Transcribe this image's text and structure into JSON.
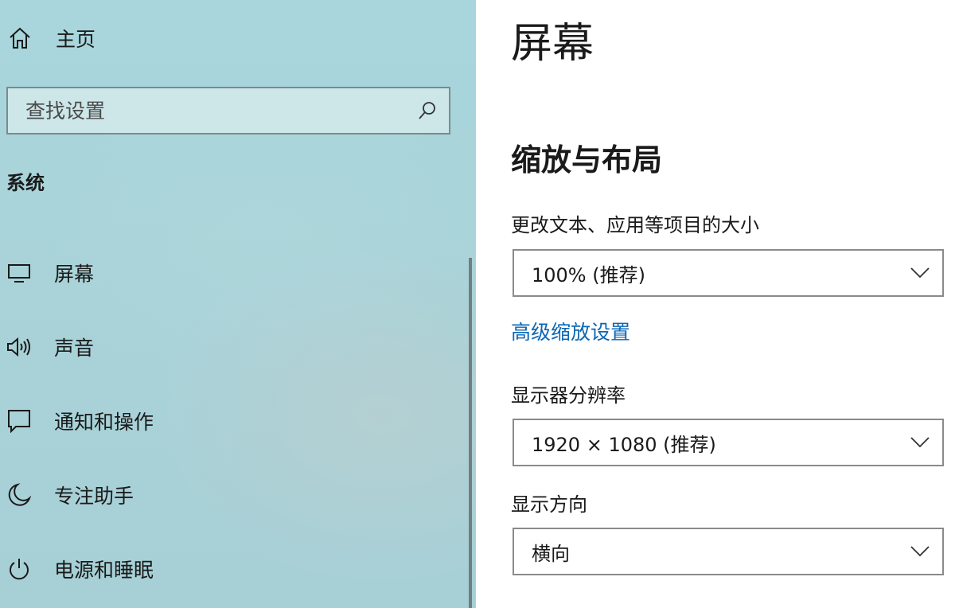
{
  "sidebar": {
    "home": {
      "label": "主页",
      "icon": "home-icon"
    },
    "search": {
      "placeholder": "查找设置",
      "icon": "search-icon"
    },
    "section_title": "系统",
    "items": [
      {
        "label": "屏幕",
        "icon": "monitor-icon"
      },
      {
        "label": "声音",
        "icon": "speaker-icon"
      },
      {
        "label": "通知和操作",
        "icon": "message-icon"
      },
      {
        "label": "专注助手",
        "icon": "moon-icon"
      },
      {
        "label": "电源和睡眠",
        "icon": "power-icon"
      }
    ]
  },
  "main": {
    "title": "屏幕",
    "scale_heading": "缩放与布局",
    "scale_label": "更改文本、应用等项目的大小",
    "scale_value": "100% (推荐)",
    "advanced_link": "高级缩放设置",
    "resolution_label": "显示器分辨率",
    "resolution_value": "1920 × 1080 (推荐)",
    "orientation_label": "显示方向",
    "orientation_value": "横向"
  },
  "colors": {
    "sidebar_bg": "#a9d4da",
    "link": "#0b67b5",
    "text": "#1a1a1a",
    "border": "#8a8a8a"
  }
}
